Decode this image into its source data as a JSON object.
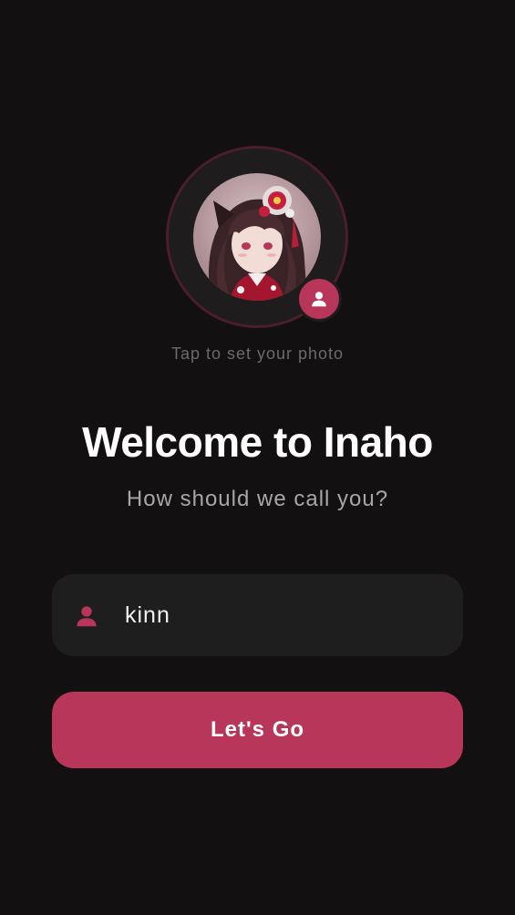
{
  "avatar": {
    "image": "profile-photo",
    "badge_icon": "person-icon",
    "hint": "Tap to set your photo"
  },
  "welcome": {
    "title": "Welcome to Inaho",
    "subtitle": "How should we call you?"
  },
  "name_field": {
    "icon": "person-icon",
    "value": "kinn"
  },
  "submit": {
    "label": "Let's Go"
  },
  "colors": {
    "background": "#121010",
    "accent": "#b8365a",
    "field_background": "#1f1e1f",
    "ring_border": "#4a1e2b"
  }
}
